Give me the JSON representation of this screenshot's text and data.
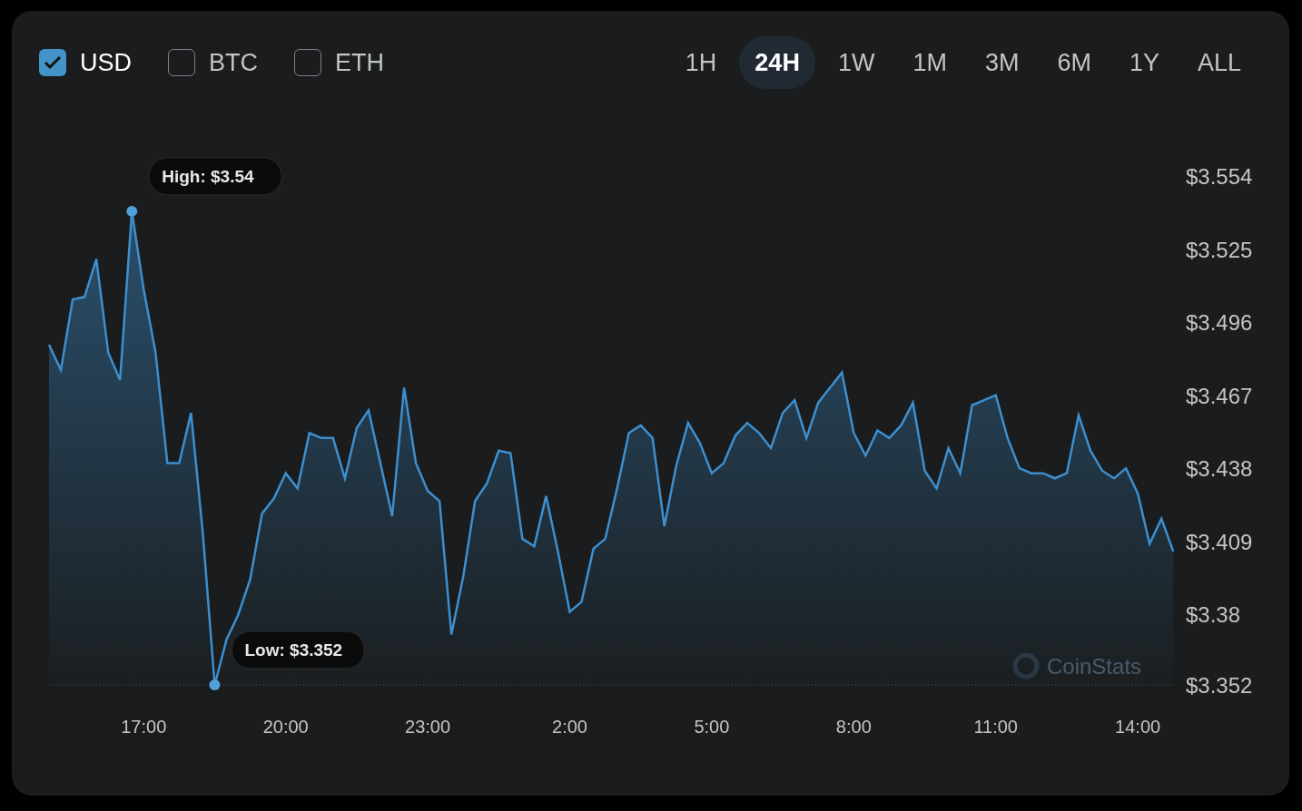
{
  "currencies": [
    {
      "label": "USD",
      "checked": true
    },
    {
      "label": "BTC",
      "checked": false
    },
    {
      "label": "ETH",
      "checked": false
    }
  ],
  "ranges": [
    {
      "label": "1H",
      "selected": false
    },
    {
      "label": "24H",
      "selected": true
    },
    {
      "label": "1W",
      "selected": false
    },
    {
      "label": "1M",
      "selected": false
    },
    {
      "label": "3M",
      "selected": false
    },
    {
      "label": "6M",
      "selected": false
    },
    {
      "label": "1Y",
      "selected": false
    },
    {
      "label": "ALL",
      "selected": false
    }
  ],
  "chart": {
    "watermark": "CoinStats",
    "chart_data": {
      "type": "area",
      "categories": [
        null,
        null,
        null,
        null,
        null,
        null,
        null,
        null,
        "17:00",
        null,
        null,
        null,
        null,
        null,
        null,
        null,
        null,
        null,
        null,
        null,
        "20:00",
        null,
        null,
        null,
        null,
        null,
        null,
        null,
        null,
        null,
        null,
        null,
        "23:00",
        null,
        null,
        null,
        null,
        null,
        null,
        null,
        null,
        null,
        null,
        null,
        "2:00",
        null,
        null,
        null,
        null,
        null,
        null,
        null,
        null,
        null,
        null,
        null,
        "5:00",
        null,
        null,
        null,
        null,
        null,
        null,
        null,
        null,
        null,
        null,
        null,
        "8:00",
        null,
        null,
        null,
        null,
        null,
        null,
        null,
        null,
        null,
        null,
        null,
        "11:00",
        null,
        null,
        null,
        null,
        null,
        null,
        null,
        null,
        null,
        null,
        null,
        "14:00",
        null,
        null,
        null
      ],
      "series": [
        {
          "color": "#3d8fcf",
          "values": [
            3.487,
            3.477,
            3.505,
            3.506,
            3.521,
            3.484,
            3.473,
            3.54,
            3.509,
            3.484,
            3.44,
            3.44,
            3.46,
            3.412,
            3.352,
            3.37,
            3.38,
            3.394,
            3.42,
            3.426,
            3.436,
            3.43,
            3.452,
            3.45,
            3.45,
            3.434,
            3.454,
            3.461,
            3.44,
            3.419,
            3.47,
            3.44,
            3.429,
            3.425,
            3.372,
            3.395,
            3.425,
            3.432,
            3.445,
            3.444,
            3.41,
            3.407,
            3.427,
            3.405,
            3.381,
            3.385,
            3.406,
            3.41,
            3.43,
            3.452,
            3.455,
            3.45,
            3.415,
            3.439,
            3.456,
            3.448,
            3.436,
            3.44,
            3.451,
            3.456,
            3.452,
            3.446,
            3.46,
            3.465,
            3.45,
            3.464,
            3.47,
            3.476,
            3.452,
            3.443,
            3.453,
            3.45,
            3.455,
            3.464,
            3.437,
            3.43,
            3.446,
            3.436,
            3.463,
            3.465,
            3.467,
            3.45,
            3.438,
            3.436,
            3.436,
            3.434,
            3.436,
            3.459,
            3.445,
            3.437,
            3.434,
            3.438,
            3.428,
            3.408,
            3.418,
            3.405
          ]
        }
      ],
      "ylim": [
        3.352,
        3.554
      ],
      "yticks": [
        {
          "value": 3.554,
          "label": "$3.554"
        },
        {
          "value": 3.525,
          "label": "$3.525"
        },
        {
          "value": 3.496,
          "label": "$3.496"
        },
        {
          "value": 3.467,
          "label": "$3.467"
        },
        {
          "value": 3.438,
          "label": "$3.438"
        },
        {
          "value": 3.409,
          "label": "$3.409"
        },
        {
          "value": 3.38,
          "label": "$3.38"
        },
        {
          "value": 3.352,
          "label": "$3.352"
        }
      ],
      "annotations": [
        "High: $3.54",
        "Low: $3.352"
      ]
    }
  }
}
